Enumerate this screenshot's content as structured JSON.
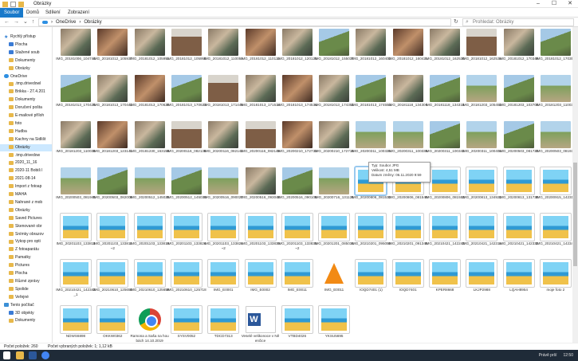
{
  "window": {
    "title": "Obrázky",
    "controls": [
      "–",
      "☐",
      "✕"
    ]
  },
  "ribbon": {
    "tabs": [
      "Soubor",
      "Domů",
      "Sdílení",
      "Zobrazení"
    ]
  },
  "address": {
    "path": [
      "OneDrive",
      "Obrázky"
    ],
    "search_placeholder": "Prohledat: Obrázky"
  },
  "sidebar": {
    "items": [
      {
        "label": "Rychlý přístup",
        "icon": "star"
      },
      {
        "label": "Plocha",
        "icon": "blue"
      },
      {
        "label": "Stažené soub",
        "icon": "blue"
      },
      {
        "label": "Dokumenty",
        "icon": "folder"
      },
      {
        "label": "Obrázky",
        "icon": "folder"
      },
      {
        "label": "OneDrive",
        "icon": "cloud"
      },
      {
        "label": ".tmp.drivedowl",
        "icon": "folder"
      },
      {
        "label": "Brikka - 27.4.201",
        "icon": "folder"
      },
      {
        "label": "Dokumenty",
        "icon": "folder"
      },
      {
        "label": "Doručení pošta",
        "icon": "folder"
      },
      {
        "label": "E-mailové příloh",
        "icon": "folder"
      },
      {
        "label": "foto",
        "icon": "folder"
      },
      {
        "label": "Hudba",
        "icon": "folder"
      },
      {
        "label": "Kachny na Sidlišt",
        "icon": "folder"
      },
      {
        "label": "Obrázky",
        "icon": "folder",
        "selected": true
      },
      {
        "label": ".tmp.drivedow",
        "icon": "folder"
      },
      {
        "label": "2020_11_16",
        "icon": "folder"
      },
      {
        "label": "2020-11 Bobiš l",
        "icon": "folder"
      },
      {
        "label": "2021-08-14",
        "icon": "folder"
      },
      {
        "label": "Import z fotoap",
        "icon": "folder"
      },
      {
        "label": "MAHA",
        "icon": "folder"
      },
      {
        "label": "Nahrané z mob",
        "icon": "folder"
      },
      {
        "label": "Obrázky",
        "icon": "folder"
      },
      {
        "label": "Saved Pictures",
        "icon": "folder"
      },
      {
        "label": "Skenované obr",
        "icon": "folder"
      },
      {
        "label": "Snímky obrazov",
        "icon": "folder"
      },
      {
        "label": "Vykop pro opti",
        "icon": "folder"
      },
      {
        "label": "Z fotoaparátu",
        "icon": "folder"
      },
      {
        "label": "Pamatky",
        "icon": "folder"
      },
      {
        "label": "Pictures",
        "icon": "folder"
      },
      {
        "label": "Plocha",
        "icon": "folder"
      },
      {
        "label": "Různé zprávy",
        "icon": "folder"
      },
      {
        "label": "Spolide",
        "icon": "folder"
      },
      {
        "label": "Veřejné",
        "icon": "folder"
      },
      {
        "label": "Tento počítač",
        "icon": "pc"
      },
      {
        "label": "3D objekty",
        "icon": "blue"
      },
      {
        "label": "Dokumenty",
        "icon": "folder"
      }
    ]
  },
  "files": [
    {
      "name": "IMG_20181006_104744",
      "t": "photo"
    },
    {
      "name": "IMG_20181012_105937",
      "t": "photo5"
    },
    {
      "name": "IMG_20181012_105951",
      "t": "photo"
    },
    {
      "name": "IMG_20181012_105958",
      "t": "photo3"
    },
    {
      "name": "IMG_20181012_110055",
      "t": "photo"
    },
    {
      "name": "IMG_20181012_110113",
      "t": "photo5"
    },
    {
      "name": "IMG_20181012_120125",
      "t": "photo"
    },
    {
      "name": "IMG_20181012_155037",
      "t": "photo2"
    },
    {
      "name": "IMG_20181012_160403",
      "t": "photo"
    },
    {
      "name": "IMG_20181012_160421",
      "t": "photo5"
    },
    {
      "name": "IMG_20181012_162530",
      "t": "photo"
    },
    {
      "name": "IMG_20181012_162534",
      "t": "photo3"
    },
    {
      "name": "IMG_20181012_170349",
      "t": "photo"
    },
    {
      "name": "IMG_20181012_170353",
      "t": "photo2"
    },
    {
      "name": "IMG_20181013_170425",
      "t": "photo2"
    },
    {
      "name": "IMG_20181013_170442",
      "t": "photo"
    },
    {
      "name": "IMG_20181013_170620",
      "t": "photo5"
    },
    {
      "name": "IMG_20181013_170623",
      "t": "photo2"
    },
    {
      "name": "IMG_20181013_171449",
      "t": "photo3"
    },
    {
      "name": "IMG_20181013_171514",
      "t": "photo"
    },
    {
      "name": "IMG_20181013_174534",
      "t": "photo5"
    },
    {
      "name": "IMG_20181013_174352",
      "t": "photo"
    },
    {
      "name": "IMG_20181013_174553",
      "t": "photo2"
    },
    {
      "name": "IMG_20181118_134306",
      "t": "photo"
    },
    {
      "name": "IMG_20181118_134315",
      "t": "photo2"
    },
    {
      "name": "IMG_20181203_105453",
      "t": "photo4"
    },
    {
      "name": "IMG_20181203_103700",
      "t": "photo2"
    },
    {
      "name": "IMG_20181203_110038",
      "t": "photo4"
    },
    {
      "name": "IMG_20181203_110039",
      "t": "photo"
    },
    {
      "name": "IMG_20181203_123141",
      "t": "photo5"
    },
    {
      "name": "IMG_20181230_163155",
      "t": "photo"
    },
    {
      "name": "IMG_20200116_082138",
      "t": "photo3"
    },
    {
      "name": "IMG_20200116_082142",
      "t": "photo"
    },
    {
      "name": "IMG_20200116_082149",
      "t": "photo3"
    },
    {
      "name": "IMG_20200210_172732",
      "t": "photo5"
    },
    {
      "name": "IMG_20200210_172718",
      "t": "photo"
    },
    {
      "name": "IMG_20200311_100326",
      "t": "photo4"
    },
    {
      "name": "IMG_20200311_100336",
      "t": "photo4"
    },
    {
      "name": "IMG_20200311_100343",
      "t": "photo2"
    },
    {
      "name": "IMG_20200311_100404",
      "t": "photo4"
    },
    {
      "name": "IMG_20200503_081723",
      "t": "photo2"
    },
    {
      "name": "IMG_20200503_081937",
      "t": "photo4"
    },
    {
      "name": "IMG_20200503_081945",
      "t": "photo4"
    },
    {
      "name": "IMG_20200503_082008",
      "t": "photo2"
    },
    {
      "name": "IMG_20200512_145025",
      "t": "photo4"
    },
    {
      "name": "IMG_20200512_145030",
      "t": "photo2"
    },
    {
      "name": "IMG_20200516_090027",
      "t": "photo4"
    },
    {
      "name": "IMG_20200516_093040",
      "t": "photo"
    },
    {
      "name": "IMG_20200516_090108",
      "t": "photo2"
    },
    {
      "name": "IMG_20200716_131126",
      "t": "photo4"
    },
    {
      "name": "IMG_20200806_081533",
      "t": "ph",
      "sel": true
    },
    {
      "name": "IMG_20200806_081540",
      "t": "ph"
    },
    {
      "name": "IMG_20200806_081553",
      "t": "ph"
    },
    {
      "name": "IMG_20200813_134922",
      "t": "ph"
    },
    {
      "name": "IMG_20200813_131730",
      "t": "ph"
    },
    {
      "name": "IMG_20200915_142315",
      "t": "ph"
    },
    {
      "name": "IMG_20201103_133811",
      "t": "ph"
    },
    {
      "name": "IMG_20201103_133811~2",
      "t": "ph"
    },
    {
      "name": "IMG_20201103_133816",
      "t": "ph"
    },
    {
      "name": "IMG_20201103_133824",
      "t": "ph"
    },
    {
      "name": "IMG_20201103_133824~2",
      "t": "ph"
    },
    {
      "name": "IMG_20201103_133835",
      "t": "ph"
    },
    {
      "name": "IMG_20201103_133835~2",
      "t": "ph"
    },
    {
      "name": "IMG_20201201_085034",
      "t": "ph"
    },
    {
      "name": "IMG_20210201_095050",
      "t": "ph"
    },
    {
      "name": "IMG_20210201_091345",
      "t": "ph"
    },
    {
      "name": "IMG_20210421_142243",
      "t": "ph"
    },
    {
      "name": "IMG_20210421_142314",
      "t": "ph"
    },
    {
      "name": "IMG_20210421_142332",
      "t": "ph"
    },
    {
      "name": "IMG_20210421_142342",
      "t": "ph"
    },
    {
      "name": "IMG_20210421_142342_1",
      "t": "ph"
    },
    {
      "name": "IMG_20210610_125650",
      "t": "ph"
    },
    {
      "name": "IMG_20210610_125659",
      "t": "ph"
    },
    {
      "name": "IMG_20210610_125718",
      "t": "ph"
    },
    {
      "name": "IMG_E0001",
      "t": "ph"
    },
    {
      "name": "IMG_E0002",
      "t": "ph"
    },
    {
      "name": "IMG_E0011",
      "t": "ph"
    },
    {
      "name": "IMG_E0011",
      "t": "vlc"
    },
    {
      "name": "IOQD7401 (1)",
      "t": "ph"
    },
    {
      "name": "IOQD7401",
      "t": "ph"
    },
    {
      "name": "KPER8668",
      "t": "ph"
    },
    {
      "name": "LKJP2988",
      "t": "ph"
    },
    {
      "name": "LQAH8954",
      "t": "ph"
    },
    {
      "name": "moje foto 2",
      "t": "ph"
    },
    {
      "name": "NDWS6898",
      "t": "ph"
    },
    {
      "name": "OKKW0362",
      "t": "ph"
    },
    {
      "name": "Ramona a Saša na houbách 14.10.2019",
      "t": "chrome"
    },
    {
      "name": "SYSV0052",
      "t": "ph"
    },
    {
      "name": "TDCD7313",
      "t": "ph"
    },
    {
      "name": "Veselé velikonoce v Něenčice",
      "t": "word"
    },
    {
      "name": "VTBD4026",
      "t": "ph"
    },
    {
      "name": "YKSU5695",
      "t": "ph"
    }
  ],
  "tooltip": {
    "lines": [
      "Typ: Soubor JPG",
      "Velikost: 4,51 MB",
      "Datum změny: 06.11.2020 9:59"
    ]
  },
  "status": {
    "count": "Počet položek: 260",
    "selected": "Počet vybraných položek: 1; 1,12 kB"
  },
  "taskbar": {
    "weather": "Právě prší",
    "time": "12:50"
  }
}
